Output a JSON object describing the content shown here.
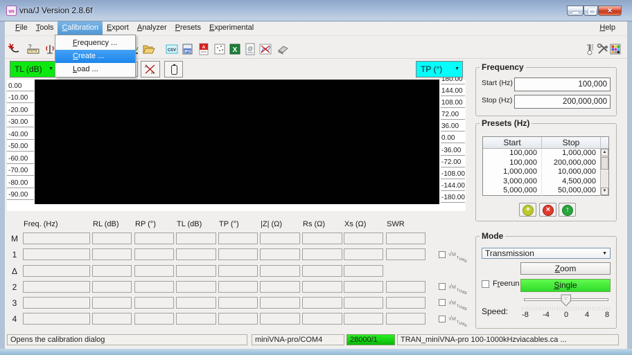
{
  "window": {
    "title": "vna/J Version 2.8.6f"
  },
  "menu": {
    "items": [
      {
        "label": "File",
        "u": 0
      },
      {
        "label": "Tools",
        "u": 0
      },
      {
        "label": "Calibration",
        "u": 0,
        "selected": true
      },
      {
        "label": "Export",
        "u": 0
      },
      {
        "label": "Analyzer",
        "u": 0
      },
      {
        "label": "Presets",
        "u": 0
      },
      {
        "label": "Experimental",
        "u": 0
      }
    ],
    "help": {
      "label": "Help",
      "u": 0
    }
  },
  "calibration_menu": [
    {
      "label": "Frequency ...",
      "u": 0
    },
    {
      "label": "Create ...",
      "u": 0,
      "selected": true
    },
    {
      "label": "Load ...",
      "u": 0
    }
  ],
  "toolbar": {
    "left_icons": [
      "wizard-icon",
      "ruler-setup-icon",
      "antenna-icon",
      "hidden-icon-1",
      "hidden-icon-2",
      "hidden-icon-3",
      "hidden-icon-4",
      "chart-icon",
      "folder-open-icon",
      "csv-export-icon",
      "jpg-export-icon",
      "pdf-export-icon",
      "snp-export-icon",
      "xls-export-icon",
      "report-icon",
      "xy-chart-icon",
      "eraser-icon"
    ],
    "right_icons": [
      "thermometer-icon",
      "tools-icon",
      "palette-icon"
    ]
  },
  "scales": {
    "left": {
      "label": "TL (dB)",
      "color": "#0ce910"
    },
    "right": {
      "label": "TP (°)",
      "color": "#05fdfc"
    }
  },
  "chart": {
    "left_axis": [
      "0.00",
      "-10.00",
      "-20.00",
      "-30.00",
      "-40.00",
      "-50.00",
      "-60.00",
      "-70.00",
      "-80.00",
      "-90.00"
    ],
    "right_axis": [
      "180.00",
      "144.00",
      "108.00",
      "72.00",
      "36.00",
      "0.00",
      "-36.00",
      "-72.00",
      "-108.00",
      "-144.00",
      "-180.00"
    ]
  },
  "frequency": {
    "title": "Frequency",
    "start_label": "Start (Hz)",
    "start_value": "100,000",
    "stop_label": "Stop (Hz)",
    "stop_value": "200,000,000"
  },
  "presets": {
    "title": "Presets (Hz)",
    "columns": [
      "Start",
      "Stop"
    ],
    "rows": [
      [
        "100,000",
        "1,000,000"
      ],
      [
        "100,000",
        "200,000,000"
      ],
      [
        "1,000,000",
        "10,000,000"
      ],
      [
        "3,000,000",
        "4,500,000"
      ],
      [
        "5,000,000",
        "50,000,000"
      ]
    ]
  },
  "mode": {
    "title": "Mode",
    "selected_mode": "Transmission",
    "zoom": {
      "label": "Zoom",
      "u": 0
    },
    "freerun": {
      "label": "Freerun",
      "u": 1
    },
    "single": {
      "label": "Single",
      "u": 0
    },
    "speed_label": "Speed:",
    "slider_ticks": [
      "-8",
      "-4",
      "0",
      "4",
      "8"
    ]
  },
  "table": {
    "columns": [
      "Freq. (Hz)",
      "RL (dB)",
      "RP (°)",
      "TL (dB)",
      "TP (°)",
      "|Z| (Ω)",
      "Rs (Ω)",
      "Xs (Ω)",
      "SWR"
    ],
    "rows": [
      "M",
      "1",
      "Δ",
      "2",
      "3",
      "4"
    ]
  },
  "status": {
    "message": "Opens the calibration dialog",
    "port": "miniVNA-pro/COM4",
    "samples": "28000/1",
    "samples_color": "#0abd09",
    "calibration_file": "TRAN_miniVNA-pro 100-1000kHzviacables.ca ..."
  }
}
